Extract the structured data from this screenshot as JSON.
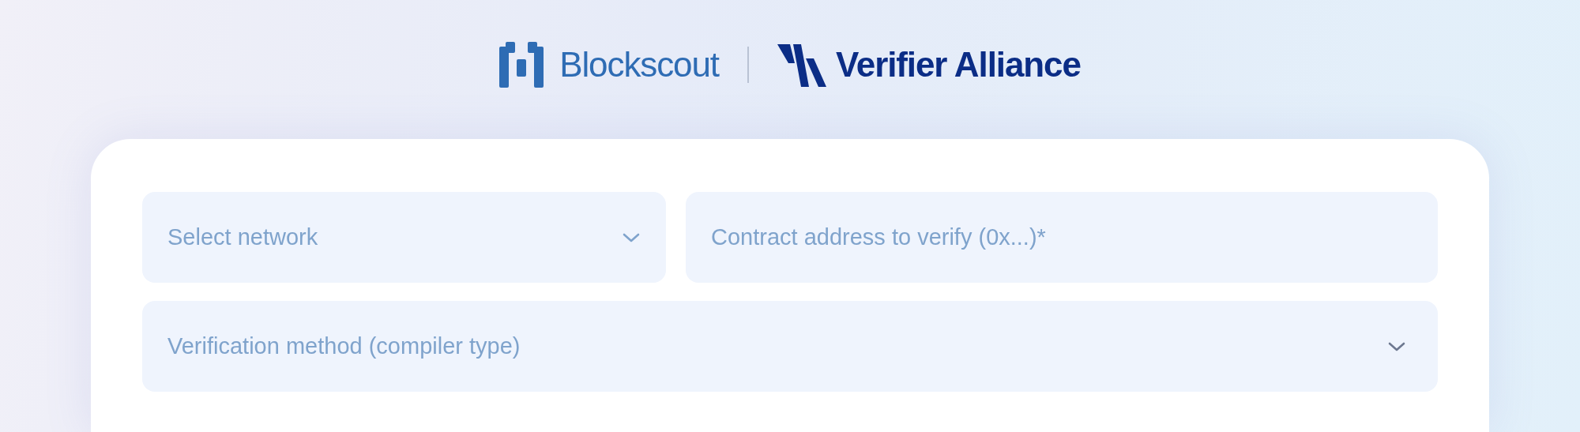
{
  "header": {
    "brand": "Blockscout",
    "partner": "Verifier Alliance"
  },
  "form": {
    "network_select": {
      "placeholder": "Select network"
    },
    "address_field": {
      "placeholder": "Contract address to verify (0x...)*"
    },
    "method_select": {
      "placeholder": "Verification method (compiler type)"
    }
  }
}
